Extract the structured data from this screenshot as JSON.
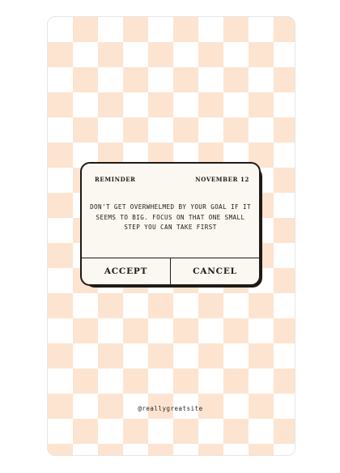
{
  "reminder": {
    "label": "REMINDER",
    "date": "NOVEMBER 12",
    "message": "DON'T GET OVERWHELMED BY YOUR GOAL IF IT SEEMS TO BIG. FOCUS ON THAT ONE SMALL STEP YOU CAN TAKE FIRST",
    "accept_label": "ACCEPT",
    "cancel_label": "CANCEL"
  },
  "footer": {
    "handle": "@reallygreatsite"
  },
  "colors": {
    "checker": "#fde4d0",
    "dialog_bg": "#fbf7f1",
    "ink": "#1e1a17"
  }
}
